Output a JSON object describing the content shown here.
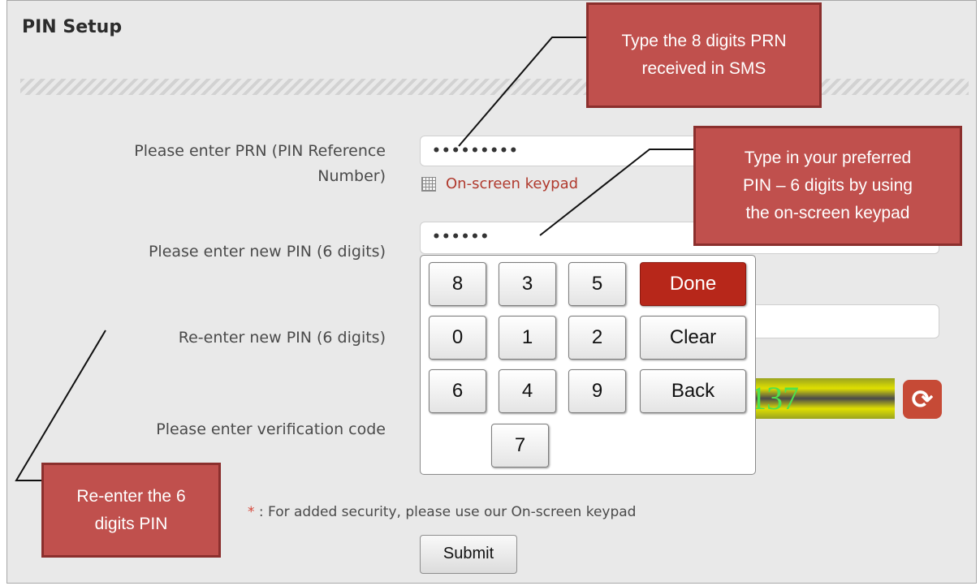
{
  "page": {
    "title": "PIN Setup"
  },
  "form": {
    "prn_label_line1": "Please enter PRN (PIN Reference",
    "prn_label_line2": "Number)",
    "prn_value": "•••••••••",
    "keypad_link": "On-screen keypad",
    "new_pin_label": "Please enter new PIN (6 digits)",
    "new_pin_value": "••••••",
    "reenter_label": "Re-enter new PIN (6 digits)",
    "reenter_value": "",
    "verification_label": "Please enter verification code",
    "captcha_text": "137",
    "security_star": "*",
    "security_note": " : For added security, please use our On-screen keypad",
    "submit_label": "Submit"
  },
  "keypad": {
    "row1": [
      "8",
      "3",
      "5"
    ],
    "row2": [
      "0",
      "1",
      "2"
    ],
    "row3": [
      "6",
      "4",
      "9"
    ],
    "row4": [
      "7"
    ],
    "done": "Done",
    "clear": "Clear",
    "back": "Back"
  },
  "callouts": {
    "prn_line1": "Type the 8 digits PRN",
    "prn_line2": "received in SMS",
    "pin_line1": "Type in your preferred",
    "pin_line2": "PIN – 6 digits by using",
    "pin_line3": "the on-screen keypad",
    "reenter_line1": "Re-enter the 6",
    "reenter_line2": "digits PIN"
  },
  "colors": {
    "callout_fill": "#c0504d",
    "done_key": "#b7271a",
    "link": "#b03a2e"
  },
  "icons": [
    "keypad-icon",
    "refresh-icon"
  ]
}
